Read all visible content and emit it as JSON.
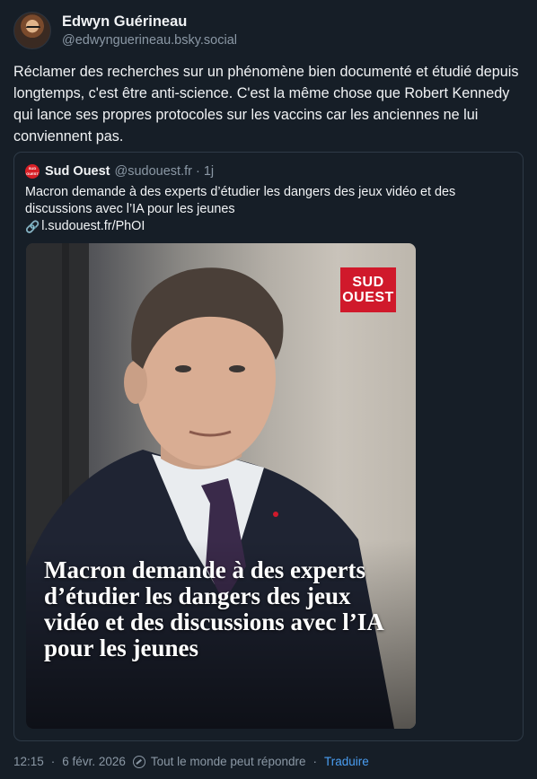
{
  "author": {
    "display_name": "Edwyn Guérineau",
    "handle": "@edwynguerineau.bsky.social"
  },
  "post": {
    "text": "Réclamer des recherches sur un phénomène bien documenté et étudié depuis longtemps, c'est être anti-science. C'est la même chose que Robert Kennedy qui lance ses propres protocoles sur les vaccins car les anciennes ne lui conviennent pas."
  },
  "quote": {
    "author_name": "Sud Ouest",
    "author_handle": "@sudouest.fr",
    "separator": "·",
    "time": "1j",
    "avatar_text": "SUD OUEST",
    "text": "Macron demande à des experts d’étudier les dangers des jeux vidéo et des discussions avec l’IA pour les jeunes",
    "link_icon": "🔗",
    "link": "l.sudouest.fr/PhOI",
    "media": {
      "logo_line1": "SUD",
      "logo_line2": "OUEST",
      "headline": "Macron demande à des experts d’étudier les dangers des jeux vidéo et des discussions avec l’IA pour les jeunes"
    }
  },
  "meta": {
    "time": "12:15",
    "date": "6 févr. 2026",
    "separator": "·",
    "reply_setting": "Tout le monde peut répondre",
    "translate": "Traduire"
  },
  "colors": {
    "background": "#161e27",
    "link": "#4a9ef2",
    "muted": "#8b98a5",
    "brand_red": "#d0192b"
  }
}
